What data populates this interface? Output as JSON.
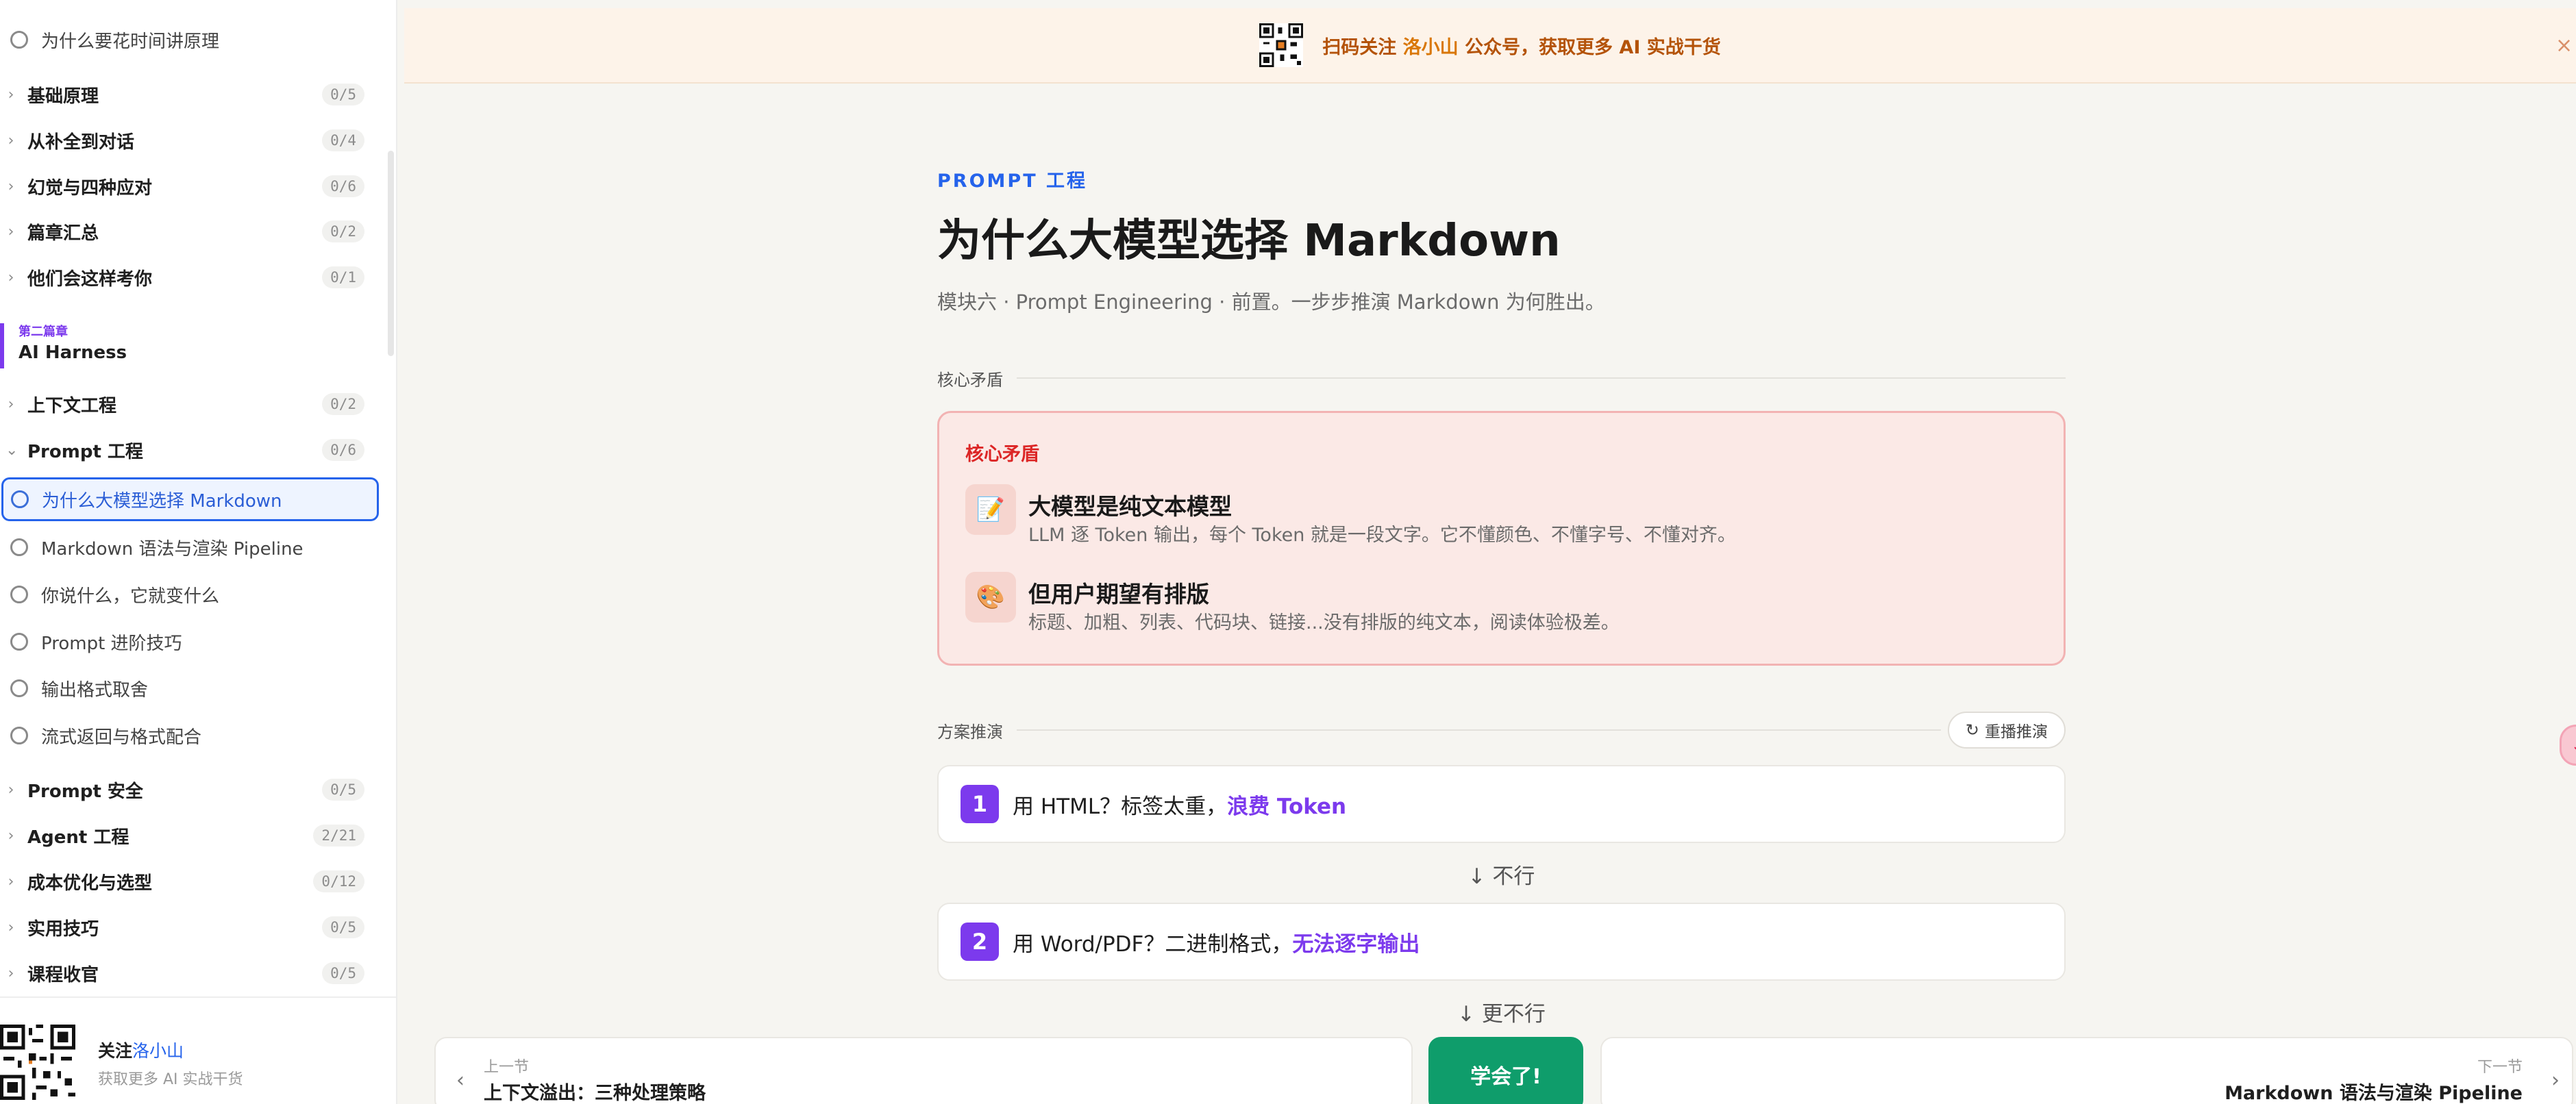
{
  "sidebar": {
    "top_lesson": "为什么要花时间讲原理",
    "groups_a": [
      {
        "label": "基础原理",
        "count": "0/5"
      },
      {
        "label": "从补全到对话",
        "count": "0/4"
      },
      {
        "label": "幻觉与四种应对",
        "count": "0/6"
      },
      {
        "label": "篇章汇总",
        "count": "0/2"
      },
      {
        "label": "他们会这样考你",
        "count": "0/1"
      }
    ],
    "chapter": {
      "tag": "第二篇章",
      "name": "AI Harness"
    },
    "groups_b": [
      {
        "label": "上下文工程",
        "count": "0/2"
      },
      {
        "label": "Prompt 工程",
        "count": "0/6"
      }
    ],
    "lessons": [
      "为什么大模型选择 Markdown",
      "Markdown 语法与渲染 Pipeline",
      "你说什么，它就变什么",
      "Prompt 进阶技巧",
      "输出格式取舍",
      "流式返回与格式配合"
    ],
    "groups_c": [
      {
        "label": "Prompt 安全",
        "count": "0/5"
      },
      {
        "label": "Agent 工程",
        "count": "2/21"
      },
      {
        "label": "成本优化与选型",
        "count": "0/12"
      },
      {
        "label": "实用技巧",
        "count": "0/5"
      },
      {
        "label": "课程收官",
        "count": "0/5"
      }
    ],
    "footer": {
      "follow_prefix": "关注",
      "follow_name": "洛小山",
      "sub": "获取更多 AI 实战干货"
    }
  },
  "banner": {
    "text_a": "扫码关注 ",
    "name": "洛小山",
    "text_b": " 公众号，获取更多 AI 实战干货",
    "close": "×"
  },
  "main": {
    "eyebrow": "PROMPT 工程",
    "title": "为什么大模型选择 Markdown",
    "subtitle": "模块六 · Prompt Engineering · 前置。一步步推演 Markdown 为何胜出。",
    "section1": "核心矛盾",
    "conflict": {
      "title": "核心矛盾",
      "items": [
        {
          "icon": "📝",
          "heading": "大模型是纯文本模型",
          "desc": "LLM 逐 Token 输出，每个 Token 就是一段文字。它不懂颜色、不懂字号、不懂对齐。"
        },
        {
          "icon": "🎨",
          "heading": "但用户期望有排版",
          "desc": "标题、加粗、列表、代码块、链接...没有排版的纯文本，阅读体验极差。"
        }
      ]
    },
    "section2": "方案推演",
    "replay": "重播推演",
    "steps": [
      {
        "num": "1",
        "text": "用 HTML？标签太重，",
        "hl": "浪费 Token"
      },
      {
        "num": "2",
        "text": "用 Word/PDF？二进制格式，",
        "hl": "无法逐字输出"
      }
    ],
    "arrows": [
      "↓ 不行",
      "↓ 更不行"
    ]
  },
  "nav": {
    "prev_small": "上一节",
    "prev_title": "上下文溢出：三种处理策略",
    "learned": "学会了!",
    "next_small": "下一节",
    "next_title": "Markdown 语法与渲染 Pipeline"
  },
  "colors": {
    "accent": "#7c3aed",
    "link": "#2563eb",
    "success": "#0f9d6b",
    "danger": "#dc2626"
  }
}
